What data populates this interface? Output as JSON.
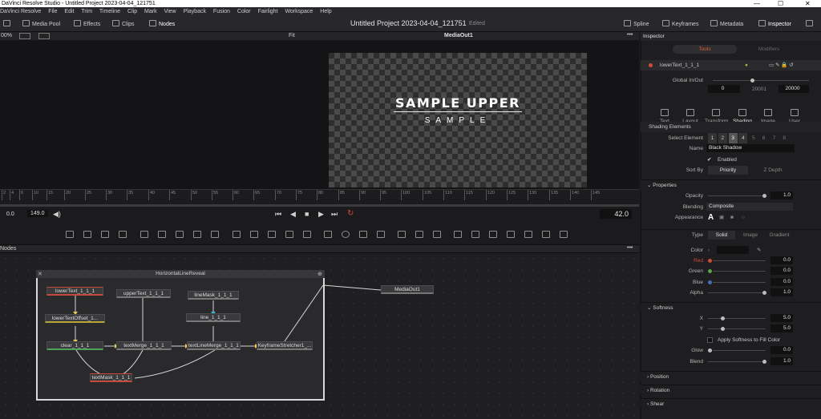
{
  "window": {
    "title": "DaVinci Resolve Studio - Untitled Project 2023-04-04_121751"
  },
  "menu": [
    "DaVinci Resolve",
    "File",
    "Edit",
    "Trim",
    "Timeline",
    "Clip",
    "Mark",
    "View",
    "Playback",
    "Fusion",
    "Color",
    "Fairlight",
    "Workspace",
    "Help"
  ],
  "toolbar": {
    "media_pool": "Media Pool",
    "effects": "Effects",
    "clips": "Clips",
    "nodes": "Nodes",
    "project_title": "Untitled Project 2023-04-04_121751",
    "edited": "Edited",
    "spline": "Spline",
    "keyframes": "Keyframes",
    "metadata": "Metadata",
    "inspector": "Inspector"
  },
  "viewer": {
    "zoom": "00%",
    "fit": "Fit",
    "name": "MediaOut1",
    "title_text": "SAMPLE UPPER",
    "subtitle_text": "SAMPLE"
  },
  "ruler": {
    "ticks": [
      "2",
      "4",
      "6",
      "10",
      "15",
      "20",
      "25",
      "30",
      "35",
      "40",
      "45",
      "50",
      "55",
      "60",
      "65",
      "70",
      "75",
      "80",
      "85",
      "90",
      "95",
      "100",
      "105",
      "110",
      "115",
      "120",
      "125",
      "130",
      "135",
      "140",
      "145"
    ]
  },
  "transport": {
    "start": "0.0",
    "end": "149.0",
    "current": "42.0"
  },
  "nodes_panel": {
    "label": "Nodes",
    "group_name": "HorizontalLineReveal",
    "nodes": {
      "lowerText": "lowerText_1_1_1",
      "upperText": "upperText_1_1_1",
      "lineMask": "lineMask_1_1_1",
      "lowerTextOffset": "lowerTextOffset_1...",
      "line": "line_1_1_1",
      "clear": "clear_1_1_1",
      "textMerge": "textMerge_1_1_1",
      "textLineMerge": "textLineMerge_1_1_1",
      "keyframeStretcher": "KeyframeStretcher1_...",
      "textMask": "textMask_1_1_1",
      "mediaOut": "MediaOut1"
    }
  },
  "inspector": {
    "title": "Inspector",
    "tabs_top": [
      "Tools",
      "Modifiers"
    ],
    "node_name": "lowerText_1_1_1",
    "global_inout_label": "Global In/Out",
    "global_in": "0",
    "global_mid": "20001",
    "global_out": "20000",
    "tabs": [
      "Text",
      "Layout",
      "Transform",
      "Shading",
      "Image",
      "User"
    ],
    "active_tab": "Shading",
    "shading_elements": "Shading Elements",
    "select_element_label": "Select Element",
    "elements": [
      "1",
      "2",
      "3",
      "4",
      "5",
      "6",
      "7",
      "8"
    ],
    "name_label": "Name",
    "name_value": "Black Shadow",
    "enabled_label": "Enabled",
    "sort_by_label": "Sort By",
    "sort_priority": "Priority",
    "sort_zdepth": "Z Depth",
    "properties": {
      "header": "Properties",
      "opacity_label": "Opacity",
      "opacity": "1.0",
      "blending_label": "Blending",
      "blending": "Composite",
      "appearance_label": "Appearance",
      "appearance_glyph": "A"
    },
    "type": {
      "label": "Type",
      "options": [
        "Solid",
        "Image",
        "Gradient"
      ]
    },
    "color": {
      "label": "Color",
      "red_label": "Red",
      "red": "0.0",
      "green_label": "Green",
      "green": "0.0",
      "blue_label": "Blue",
      "blue": "0.0",
      "alpha_label": "Alpha",
      "alpha": "1.0"
    },
    "softness": {
      "header": "Softness",
      "x_label": "X",
      "x": "5.0",
      "y_label": "Y",
      "y": "5.0",
      "apply_label": "Apply Softness to Fill Color",
      "glow_label": "Glow",
      "glow": "0.0",
      "blend_label": "Blend",
      "blend": "1.0"
    },
    "collapsed": [
      "Position",
      "Rotation",
      "Shear"
    ]
  }
}
